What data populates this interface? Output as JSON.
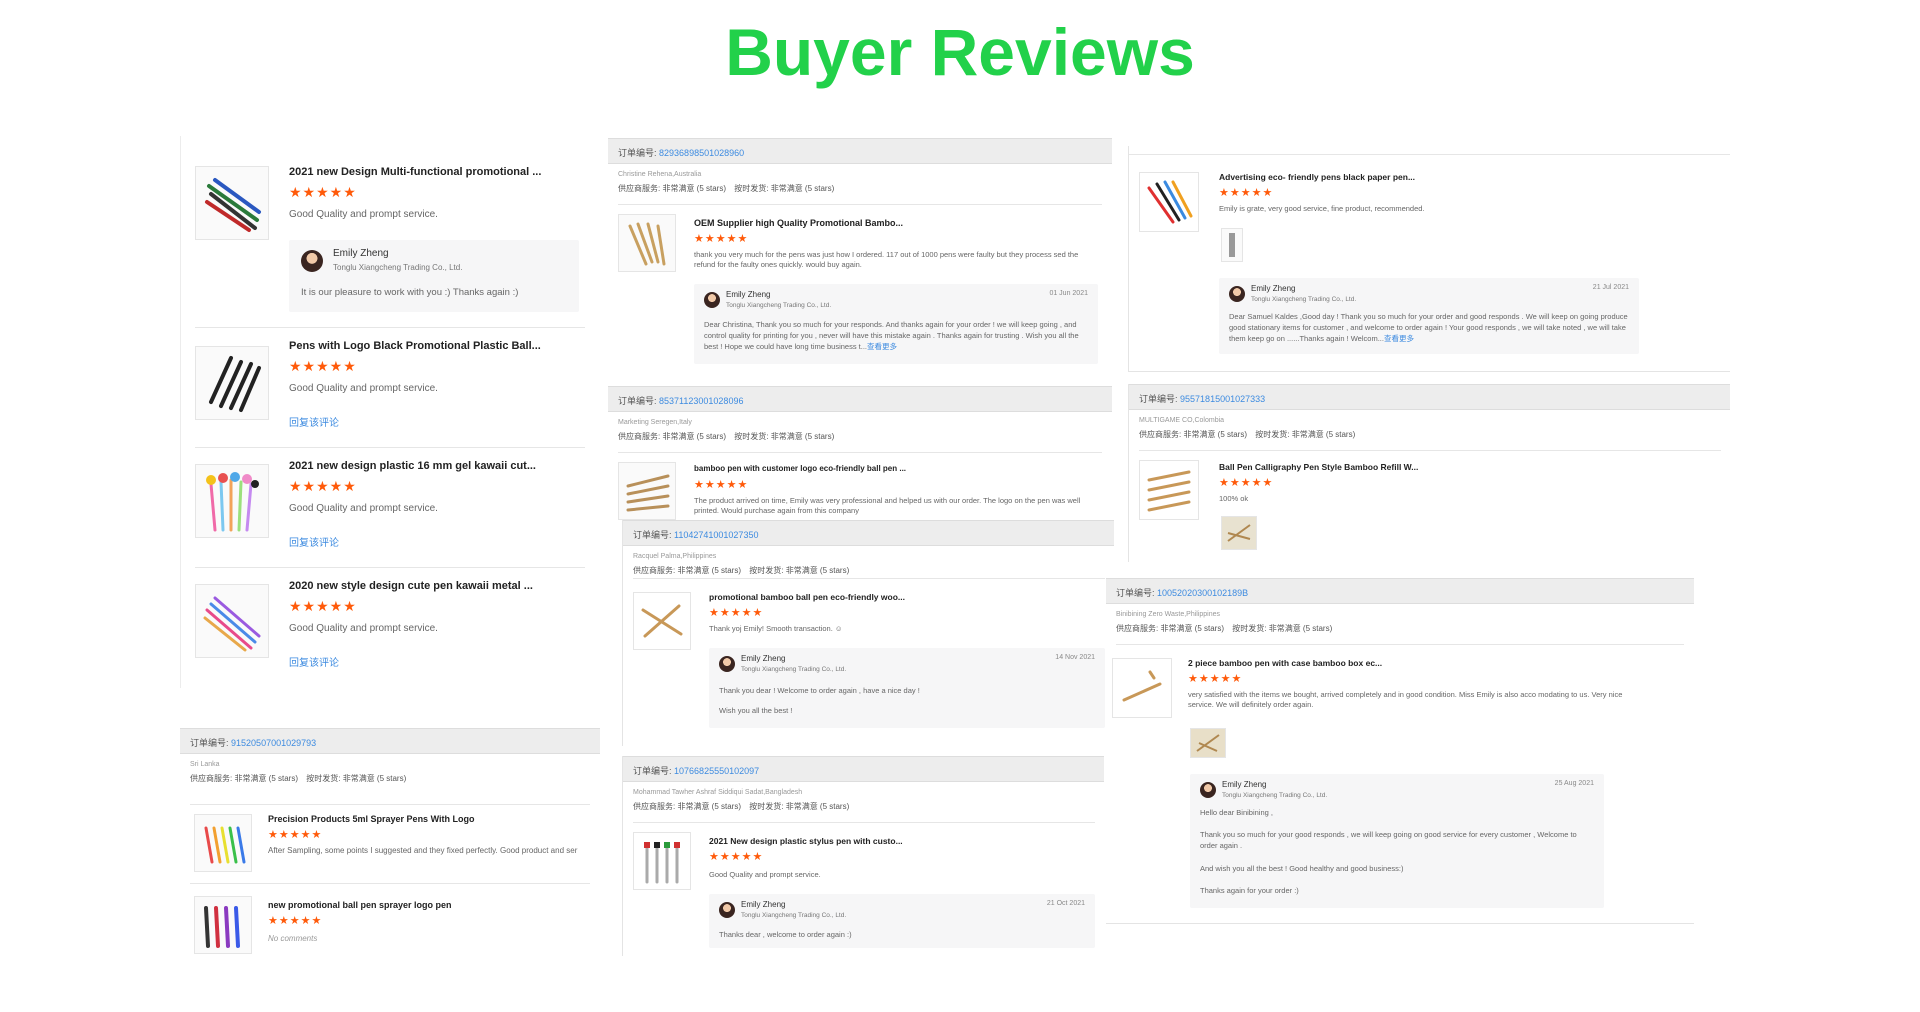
{
  "page": {
    "title": "Buyer Reviews",
    "star_text": "★★★★★",
    "accent": "#22d14a",
    "star_color": "#ff5a0a",
    "link_color": "#3d8be0"
  },
  "panel1": {
    "reviews": [
      {
        "product": "2021 new Design Multi-functional promotional ...",
        "comment": "Good Quality and prompt service.",
        "reply": {
          "name": "Emily Zheng",
          "company": "Tonglu Xiangcheng Trading Co., Ltd.",
          "text": "It is our pleasure to work with you :)  Thanks again :)"
        }
      },
      {
        "product": "Pens with Logo Black Promotional Plastic Ball...",
        "comment": "Good Quality and prompt service.",
        "link": "回复该评论"
      },
      {
        "product": "2021 new design plastic 16 mm gel kawaii cut...",
        "comment": "Good Quality and prompt service.",
        "link": "回复该评论"
      },
      {
        "product": "2020 new style design cute pen kawaii metal ...",
        "comment": "Good Quality and prompt service.",
        "link": "回复该评论"
      }
    ]
  },
  "panel2": {
    "order_label": "订单编号:",
    "order_no": "91520507001029793",
    "buyer": "Sri Lanka",
    "service": "供应商服务: 非常满意  (5 stars)",
    "delivery": "按时发货: 非常满意  (5 stars)",
    "reviews": [
      {
        "product": "Precision Products 5ml Sprayer Pens With Logo",
        "comment": "After Sampling, some points I suggested and they fixed perfectly. Good product and ser"
      },
      {
        "product": "new promotional ball pen sprayer logo pen",
        "comment": "No comments"
      }
    ]
  },
  "panel3": {
    "order_label": "订单编号:",
    "order_no": "82936898501028960",
    "buyer": "Christine Rehena,Australia",
    "service": "供应商服务: 非常满意  (5 stars)",
    "delivery": "按时发货: 非常满意  (5 stars)",
    "product": "OEM Supplier high Quality Promotional Bambo...",
    "comment": "thank you very much for the pens was just how I ordered. 117 out of 1000 pens were faulty but they process sed the refund for the faulty ones quickly. would buy again.",
    "reply": {
      "name": "Emily Zheng",
      "company": "Tonglu Xiangcheng Trading Co., Ltd.",
      "date": "01 Jun 2021",
      "text": "Dear Christina, Thank you so much for your responds. And thanks again for your order ! we will keep going , and control quality for printing for you , never will have this mistake again . Thanks again for trusting . Wish you all the best ! Hope we could have long time business t...",
      "more": "查看更多"
    }
  },
  "panel4": {
    "order_label": "订单编号:",
    "order_no": "85371123001028096",
    "buyer": "Marketing Seregen,Italy",
    "service": "供应商服务: 非常满意  (5 stars)",
    "delivery": "按时发货: 非常满意  (5 stars)",
    "product": "bamboo pen with customer logo eco-friendly ball pen ...",
    "comment": "The product arrived on time, Emily was very professional and helped us with our order. The logo on the pen was well printed. Would purchase again from this company"
  },
  "panel5": {
    "order_label": "订单编号:",
    "order_no": "11042741001027350",
    "buyer": "Racquel Palma,Philippines",
    "service": "供应商服务: 非常满意  (5 stars)",
    "delivery": "按时发货: 非常满意  (5 stars)",
    "product": "promotional bamboo ball pen eco-friendly woo...",
    "comment": "Thank yoj Emily! Smooth transaction. ☺",
    "reply": {
      "name": "Emily Zheng",
      "company": "Tonglu Xiangcheng Trading Co., Ltd.",
      "date": "14 Nov 2021",
      "text1": "Thank you dear ! Welcome to order again , have a nice day !",
      "text2": "Wish you all the best !"
    }
  },
  "panel6": {
    "order_label": "订单编号:",
    "order_no": "10766825550102097",
    "buyer": "Mohammad Tawher Ashraf Siddiqui Sadat,Bangladesh",
    "service": "供应商服务: 非常满意  (5 stars)",
    "delivery": "按时发货: 非常满意  (5 stars)",
    "product": "2021 New design plastic stylus pen with custo...",
    "comment": "Good Quality and prompt service.",
    "reply": {
      "name": "Emily Zheng",
      "company": "Tonglu Xiangcheng Trading Co., Ltd.",
      "date": "21 Oct 2021",
      "text": "Thanks dear , welcome to order again :)"
    }
  },
  "panel7": {
    "product": "Advertising eco- friendly pens black paper pen...",
    "comment": "Emily is grate, very good service, fine product, recommended.",
    "reply": {
      "name": "Emily Zheng",
      "company": "Tonglu Xiangcheng Trading Co., Ltd.",
      "date": "21 Jul 2021",
      "text": "Dear Samuel Kaldes ,Good day ! Thank you so much for your order and good responds . We will keep on going  produce good stationary items for customer , and welcome to order again ! Your good responds , we will take noted ,  we will take them keep go on ......Thanks again ! Welcom...",
      "more": "查看更多"
    }
  },
  "panel8": {
    "order_label": "订单编号:",
    "order_no": "95571815001027333",
    "buyer": "MULTIGAME CO,Colombia",
    "service": "供应商服务: 非常满意  (5 stars)",
    "delivery": "按时发货: 非常满意  (5 stars)",
    "product": "Ball Pen Calligraphy Pen Style Bamboo Refill W...",
    "comment": "100% ok"
  },
  "panel9": {
    "order_label": "订单编号:",
    "order_no": "10052020300102189B",
    "buyer": "Binibining Zero Waste,Philippines",
    "service": "供应商服务: 非常满意  (5 stars)",
    "delivery": "按时发货: 非常满意  (5 stars)",
    "product": "2 piece bamboo pen with case bamboo box ec...",
    "comment": "very satisfied with the items we bought, arrived completely and in good condition. Miss Emily is also acco modating to us. Very nice service. We will definitely order again.",
    "reply": {
      "name": "Emily Zheng",
      "company": "Tonglu Xiangcheng Trading Co., Ltd.",
      "date": "25 Aug 2021",
      "text1": "Hello dear Binibining ,",
      "text2": "Thank you so much for your good responds , we will keep going on good service for every customer , Welcome to order again .",
      "text3": "And wish you all the best ! Good healthy and good business:)",
      "text4": "Thanks again for your order :)"
    }
  }
}
